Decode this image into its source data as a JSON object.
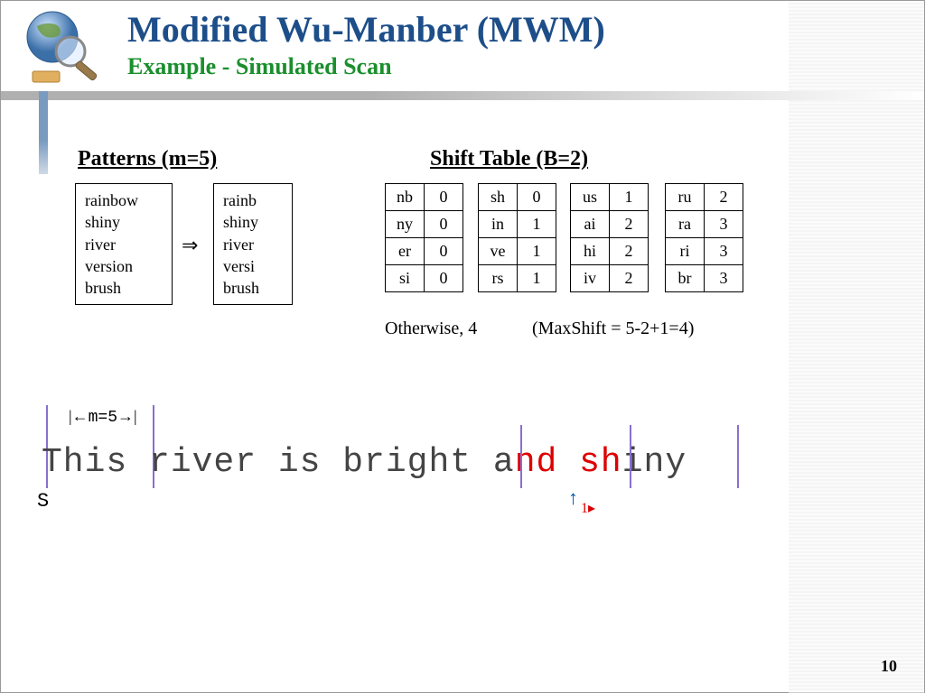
{
  "title": "Modified Wu-Manber (MWM)",
  "subtitle": "Example - Simulated Scan",
  "patterns_heading": "Patterns (m=5)",
  "shift_heading": "Shift Table (B=2)",
  "patterns_full": [
    "rainbow",
    "shiny",
    "river",
    "version",
    "brush"
  ],
  "patterns_trunc": [
    "rainb",
    "shiny",
    "river",
    "versi",
    "brush"
  ],
  "arrow_symbol": "⇒",
  "shift_tables": {
    "t1": [
      [
        "nb",
        "0"
      ],
      [
        "ny",
        "0"
      ],
      [
        "er",
        "0"
      ],
      [
        "si",
        "0"
      ]
    ],
    "t2": [
      [
        "sh",
        "0"
      ],
      [
        "in",
        "1"
      ],
      [
        "ve",
        "1"
      ],
      [
        "rs",
        "1"
      ]
    ],
    "t3": [
      [
        "us",
        "1"
      ],
      [
        "ai",
        "2"
      ],
      [
        "hi",
        "2"
      ],
      [
        "iv",
        "2"
      ]
    ],
    "t4": [
      [
        "ru",
        "2"
      ],
      [
        "ra",
        "3"
      ],
      [
        "ri",
        "3"
      ],
      [
        "br",
        "3"
      ]
    ]
  },
  "caption_otherwise": "Otherwise, 4",
  "caption_maxshift": "(MaxShift = 5-2+1=4)",
  "scan": {
    "m_label": "m=5",
    "prefix": "This river is bright a",
    "highlight": "nd sh",
    "suffix": "iny",
    "s_label": "S",
    "pointer_value": "1"
  },
  "page_number": "10"
}
